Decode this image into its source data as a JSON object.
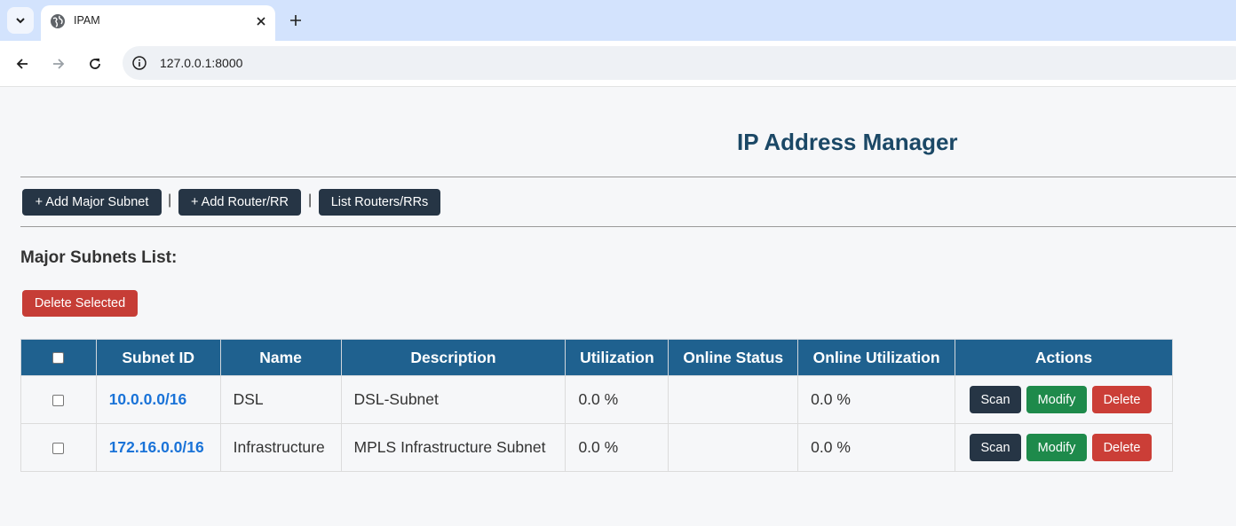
{
  "browser": {
    "tab_title": "IPAM",
    "url": "127.0.0.1:8000"
  },
  "page": {
    "title": "IP Address Manager",
    "toolbar": {
      "add_major_subnet": "+ Add Major Subnet",
      "add_router": "+ Add Router/RR",
      "list_routers": "List Routers/RRs",
      "separator": "|"
    },
    "section_title": "Major Subnets List:",
    "delete_selected": "Delete Selected"
  },
  "table": {
    "headers": [
      "Subnet ID",
      "Name",
      "Description",
      "Utilization",
      "Online Status",
      "Online Utilization",
      "Actions"
    ],
    "rows": [
      {
        "subnet_id": "10.0.0.0/16",
        "name": "DSL",
        "description": "DSL-Subnet",
        "utilization": "0.0 %",
        "online_status": "",
        "online_utilization": "0.0 %"
      },
      {
        "subnet_id": "172.16.0.0/16",
        "name": "Infrastructure",
        "description": "MPLS Infrastructure Subnet",
        "utilization": "0.0 %",
        "online_status": "",
        "online_utilization": "0.0 %"
      }
    ],
    "action_labels": {
      "scan": "Scan",
      "modify": "Modify",
      "delete": "Delete"
    }
  },
  "colors": {
    "header_bg": "#1f618f",
    "title": "#1b4866",
    "dark_button": "#263545",
    "modify_button": "#1e8a4b",
    "delete_button": "#cb3e37",
    "link": "#1a73d8"
  },
  "icons": [
    "tab-search-icon",
    "globe-icon",
    "close-icon",
    "plus-icon",
    "back-arrow-icon",
    "forward-arrow-icon",
    "reload-icon",
    "info-icon"
  ]
}
